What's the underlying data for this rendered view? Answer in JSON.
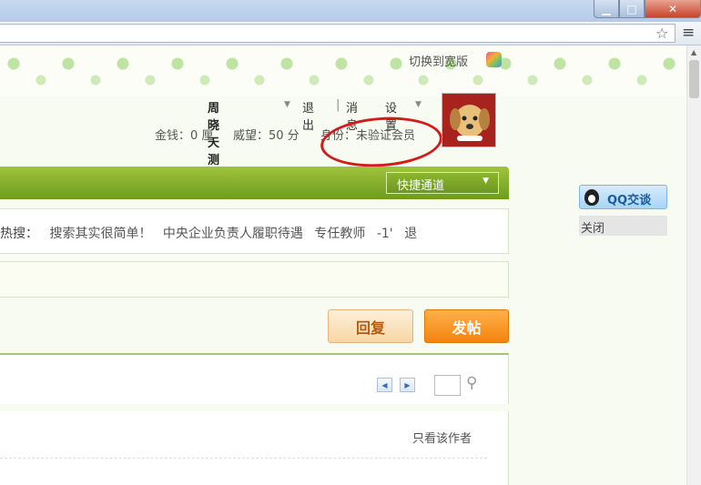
{
  "window": {
    "minimize_glyph": "▁",
    "maximize_glyph": "□",
    "close_glyph": "✕"
  },
  "browser": {
    "star_glyph": "☆",
    "menu_glyph": "≡"
  },
  "header": {
    "switch_wide_label": "切换到宽版"
  },
  "user": {
    "name": "周晓天测试",
    "logout_label": "退出",
    "separator": "|",
    "messages_label": "消息",
    "settings_label": "设置",
    "money": "金钱：0 厘",
    "prestige": "威望：50 分",
    "identity": "身份：未验证会员"
  },
  "nav": {
    "quick_access_label": "快捷通道",
    "caret_glyph": "▼"
  },
  "hot_search": {
    "label": "热搜：",
    "items": [
      "搜索其实很简单！",
      "中央企业负责人履职待遇",
      "专任教师",
      "-1'",
      "退"
    ]
  },
  "actions": {
    "reply_label": "回复",
    "post_label": "发帖"
  },
  "pager": {
    "prev_glyph": "◀",
    "next_glyph": "▶",
    "wrench_glyph": "⚲"
  },
  "post": {
    "author_only_label": "只看该作者"
  },
  "side": {
    "qq_chat_label": "QQ交谈",
    "close_label": "关闭"
  },
  "colors": {
    "nav_green": "#7fab27",
    "highlight_red": "#d21b1b",
    "post_orange": "#f38410"
  }
}
